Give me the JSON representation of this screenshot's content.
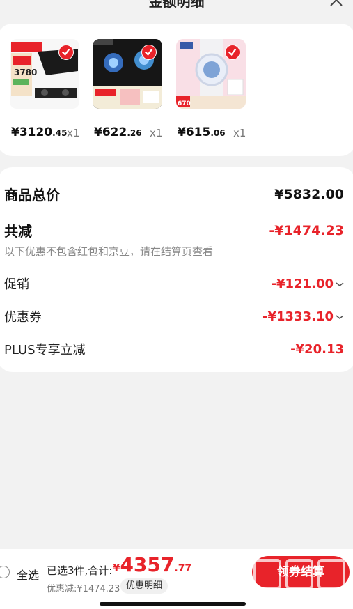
{
  "header": {
    "title": "金额明细"
  },
  "products": [
    {
      "price_int": "¥3120",
      "price_dec": ".45",
      "qty": "x1",
      "thumb_text": "3780",
      "thumb_theme": "hood"
    },
    {
      "price_int": "¥622",
      "price_dec": ".26",
      "qty": "x1",
      "thumb_text": "",
      "thumb_theme": "stove"
    },
    {
      "price_int": "¥615",
      "price_dec": ".06",
      "qty": "x1",
      "thumb_text": "670",
      "thumb_theme": "watch"
    }
  ],
  "summary": {
    "total_label": "商品总价",
    "total_value": "¥5832.00",
    "reduce_label": "共减",
    "reduce_value": "-¥1474.23",
    "note": "以下优惠不包含红包和京豆，请在结算页查看",
    "promo_label": "促销",
    "promo_value": "-¥121.00",
    "coupon_label": "优惠券",
    "coupon_value": "-¥1333.10",
    "plus_label": "PLUS专享立减",
    "plus_value": "-¥20.13"
  },
  "bottom": {
    "select_all": "全选",
    "selected_text": "已选3件,合计:",
    "total_yen": "¥",
    "total_int": "4357",
    "total_dec": ".77",
    "discount_text": "优惠减:¥1474.23",
    "detail_button": "优惠明细",
    "checkout_button": "领券结算"
  },
  "colors": {
    "accent": "#e8232a",
    "background": "#f2f2f2"
  },
  "icons": {
    "close": "close-icon",
    "check": "check-icon",
    "chevron": "chevron-down-icon"
  }
}
